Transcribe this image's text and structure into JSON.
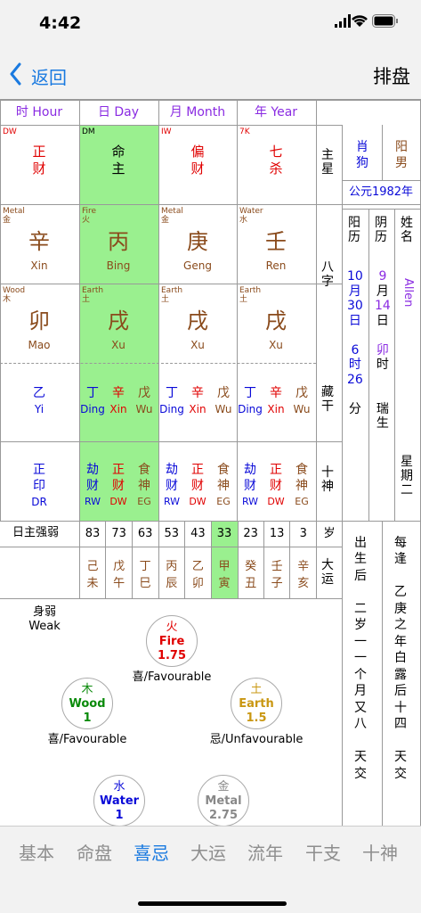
{
  "status": {
    "time": "4:42"
  },
  "nav": {
    "back": "返回",
    "title": "排盘"
  },
  "header": {
    "hour": "时 Hour",
    "day": "日 Day",
    "month": "月 Month",
    "year": "年 Year"
  },
  "shishen_top": [
    {
      "code": "DW",
      "zh1": "正",
      "zh2": "财"
    },
    {
      "code": "DM",
      "zh1": "命",
      "zh2": "主"
    },
    {
      "code": "IW",
      "zh1": "偏",
      "zh2": "财"
    },
    {
      "code": "7K",
      "zh1": "七",
      "zh2": "杀"
    }
  ],
  "side_labels": {
    "zhuxing": "主星",
    "bazi": "八字",
    "canggan": "藏干",
    "shishen": "十神",
    "sui": "岁",
    "dayun": "大运"
  },
  "zodiac": {
    "animal": "肖狗",
    "gender": "阳男",
    "year": "公元1982年"
  },
  "stems": [
    {
      "el": "Metal",
      "elzh": "金",
      "char": "辛",
      "py": "Xin"
    },
    {
      "el": "Fire",
      "elzh": "火",
      "char": "丙",
      "py": "Bing"
    },
    {
      "el": "Metal",
      "elzh": "金",
      "char": "庚",
      "py": "Geng"
    },
    {
      "el": "Water",
      "elzh": "水",
      "char": "壬",
      "py": "Ren"
    }
  ],
  "branches": [
    {
      "el": "Wood",
      "elzh": "木",
      "char": "卯",
      "py": "Mao"
    },
    {
      "el": "Earth",
      "elzh": "土",
      "char": "戌",
      "py": "Xu"
    },
    {
      "el": "Earth",
      "elzh": "土",
      "char": "戌",
      "py": "Xu"
    },
    {
      "el": "Earth",
      "elzh": "土",
      "char": "戌",
      "py": "Xu"
    }
  ],
  "hidden": [
    [
      {
        "zh": "乙",
        "py": "Yi"
      }
    ],
    [
      {
        "zh": "丁",
        "py": "Ding"
      },
      {
        "zh": "辛",
        "py": "Xin"
      },
      {
        "zh": "戊",
        "py": "Wu"
      }
    ],
    [
      {
        "zh": "丁",
        "py": "Ding"
      },
      {
        "zh": "辛",
        "py": "Xin"
      },
      {
        "zh": "戊",
        "py": "Wu"
      }
    ],
    [
      {
        "zh": "丁",
        "py": "Ding"
      },
      {
        "zh": "辛",
        "py": "Xin"
      },
      {
        "zh": "戊",
        "py": "Wu"
      }
    ]
  ],
  "tengods": [
    [
      {
        "zh1": "正",
        "zh2": "印",
        "en": "DR"
      }
    ],
    [
      {
        "zh1": "劫",
        "zh2": "财",
        "en": "RW"
      },
      {
        "zh1": "正",
        "zh2": "财",
        "en": "DW"
      },
      {
        "zh1": "食",
        "zh2": "神",
        "en": "EG"
      }
    ],
    [
      {
        "zh1": "劫",
        "zh2": "财",
        "en": "RW"
      },
      {
        "zh1": "正",
        "zh2": "财",
        "en": "DW"
      },
      {
        "zh1": "食",
        "zh2": "神",
        "en": "EG"
      }
    ],
    [
      {
        "zh1": "劫",
        "zh2": "财",
        "en": "RW"
      },
      {
        "zh1": "正",
        "zh2": "财",
        "en": "DW"
      },
      {
        "zh1": "食",
        "zh2": "神",
        "en": "EG"
      }
    ]
  ],
  "calendar": {
    "solar_label": "阳历",
    "solar": [
      "10",
      "月",
      "30",
      "日",
      "",
      "6",
      "时",
      "26",
      "",
      "分"
    ],
    "lunar_label": "阴历",
    "lunar": [
      "9",
      "月",
      "14",
      "日",
      "",
      "卯",
      "时",
      "",
      "",
      "瑞",
      "生"
    ],
    "name_label": "姓名",
    "name": "Allen",
    "week": "星期二"
  },
  "strength_label": "日主强弱",
  "ages": [
    "83",
    "73",
    "63",
    "53",
    "43",
    "33",
    "23",
    "13",
    "3"
  ],
  "dayun": [
    [
      "己",
      "未"
    ],
    [
      "戊",
      "午"
    ],
    [
      "丁",
      "巳"
    ],
    [
      "丙",
      "辰"
    ],
    [
      "乙",
      "卯"
    ],
    [
      "甲",
      "寅"
    ],
    [
      "癸",
      "丑"
    ],
    [
      "壬",
      "子"
    ],
    [
      "辛",
      "亥"
    ]
  ],
  "after_birth": [
    "出",
    "生",
    "后",
    "",
    "二",
    "岁",
    "一",
    "一",
    "个",
    "月",
    "又",
    "八",
    "",
    "天",
    "交"
  ],
  "each_meet": [
    "每",
    "逢",
    "",
    "乙",
    "庚",
    "之",
    "年",
    "白",
    "露",
    "后",
    "十",
    "四",
    "",
    "天",
    "交"
  ],
  "strength": {
    "zh": "身弱",
    "en": "Weak"
  },
  "elements": [
    {
      "zh": "火",
      "en": "Fire",
      "val": "1.75",
      "note": "喜/Favourable",
      "color": "#e00000"
    },
    {
      "zh": "木",
      "en": "Wood",
      "val": "1",
      "note": "喜/Favourable",
      "color": "#0a8a0a"
    },
    {
      "zh": "土",
      "en": "Earth",
      "val": "1.5",
      "note": "忌/Unfavourable",
      "color": "#c99712"
    },
    {
      "zh": "水",
      "en": "Water",
      "val": "1",
      "note": "",
      "color": "#0a0ad8"
    },
    {
      "zh": "金",
      "en": "Metal",
      "val": "2.75",
      "note": "",
      "color": "#888888"
    }
  ],
  "tabs": [
    "基本",
    "命盘",
    "喜忌",
    "大运",
    "流年",
    "干支",
    "十神"
  ],
  "active_tab": 2,
  "colors": {
    "accent": "#1a7ae0",
    "highlight": "#9af08f"
  }
}
